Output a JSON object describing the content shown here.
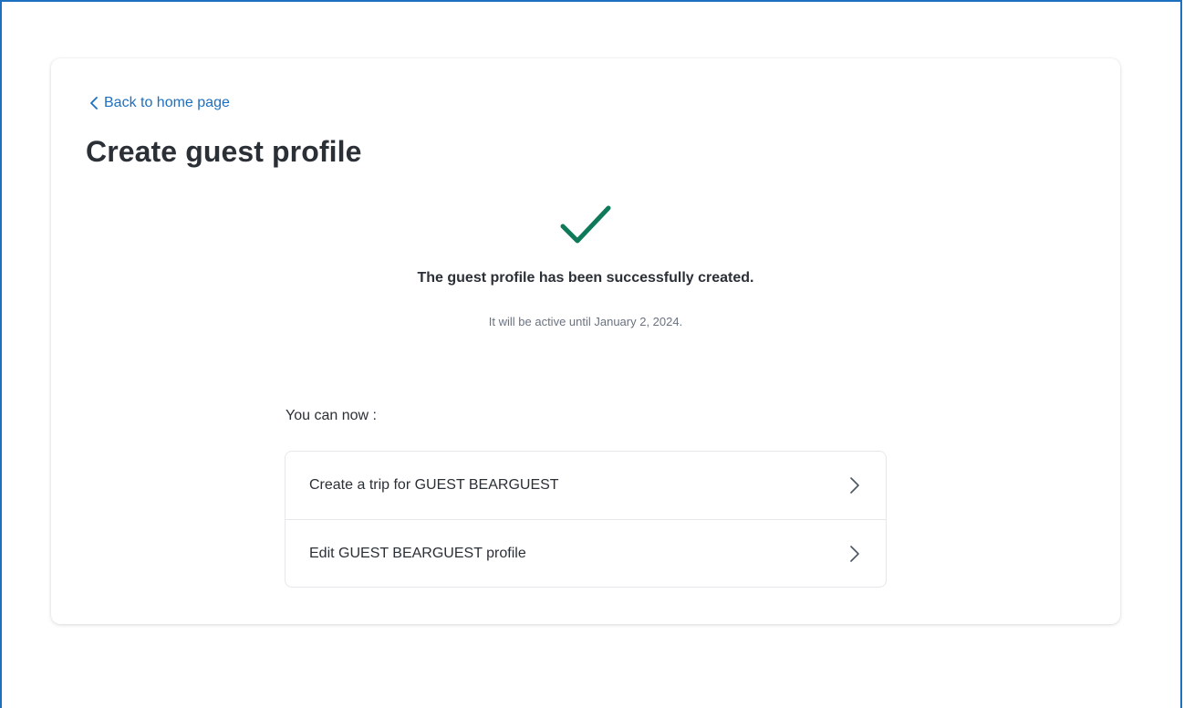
{
  "back_link": {
    "label": "Back to home page",
    "icon": "chevron-left-icon"
  },
  "page_title": "Create guest profile",
  "success": {
    "icon": "checkmark-icon",
    "icon_color": "#0f7a5a",
    "title": "The guest profile has been successfully created.",
    "subtitle": "It will be active until January 2, 2024."
  },
  "next_steps": {
    "heading": "You can now :",
    "items": [
      {
        "label": "Create a trip for GUEST BEARGUEST",
        "icon": "chevron-right-icon"
      },
      {
        "label": "Edit GUEST BEARGUEST profile",
        "icon": "chevron-right-icon"
      }
    ]
  },
  "colors": {
    "link": "#1d6fbf",
    "frame_border": "#1d6fbf",
    "success": "#0f7a5a"
  }
}
